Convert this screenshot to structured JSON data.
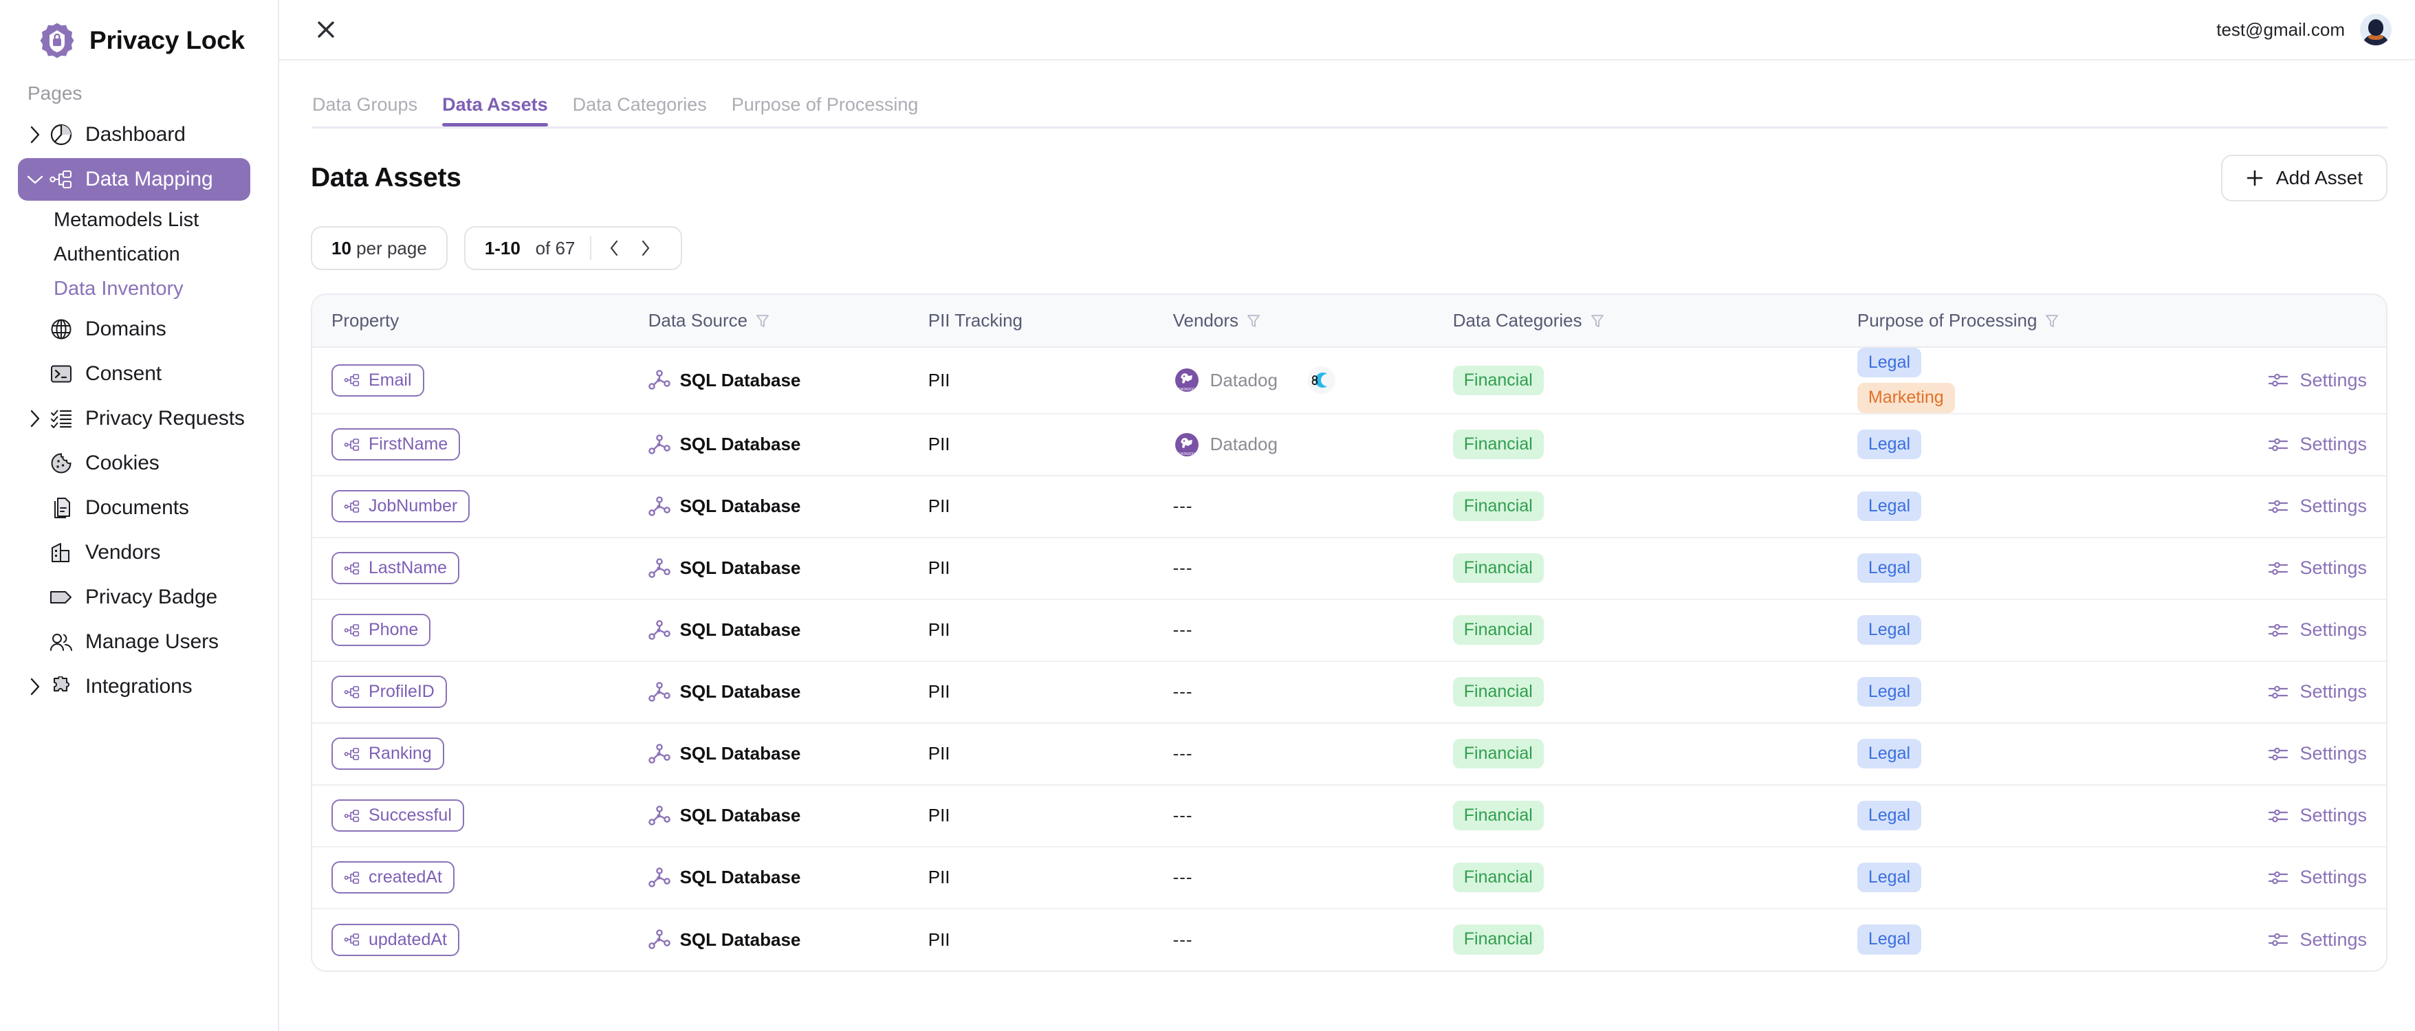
{
  "brand": {
    "title": "Privacy Lock",
    "logo_icon": "shield-lock-badge-icon",
    "color": "#8b72b8"
  },
  "sidebar": {
    "section_label": "Pages",
    "items": [
      {
        "label": "Dashboard",
        "icon": "pie-chart-icon",
        "expandable": true,
        "active": false
      },
      {
        "label": "Data Mapping",
        "icon": "sitemap-icon",
        "expandable": true,
        "active": true
      },
      {
        "label": "Domains",
        "icon": "globe-icon",
        "expandable": false,
        "active": false
      },
      {
        "label": "Consent",
        "icon": "terminal-icon",
        "expandable": false,
        "active": false
      },
      {
        "label": "Privacy Requests",
        "icon": "checklist-icon",
        "expandable": true,
        "active": false
      },
      {
        "label": "Cookies",
        "icon": "cookie-icon",
        "expandable": false,
        "active": false
      },
      {
        "label": "Documents",
        "icon": "documents-icon",
        "expandable": false,
        "active": false
      },
      {
        "label": "Vendors",
        "icon": "building-icon",
        "expandable": false,
        "active": false
      },
      {
        "label": "Privacy Badge",
        "icon": "tag-icon",
        "expandable": false,
        "active": false
      },
      {
        "label": "Manage Users",
        "icon": "users-icon",
        "expandable": false,
        "active": false
      },
      {
        "label": "Integrations",
        "icon": "puzzle-icon",
        "expandable": true,
        "active": false
      }
    ],
    "sub_items": [
      {
        "label": "Metamodels List",
        "current": false
      },
      {
        "label": "Authentication",
        "current": false
      },
      {
        "label": "Data Inventory",
        "current": true
      }
    ]
  },
  "topbar": {
    "close_icon": "close-icon",
    "user_email": "test@gmail.com",
    "avatar_icon": "user-avatar"
  },
  "tabs": [
    {
      "label": "Data Groups",
      "active": false
    },
    {
      "label": "Data Assets",
      "active": true
    },
    {
      "label": "Data Categories",
      "active": false
    },
    {
      "label": "Purpose of Processing",
      "active": false
    }
  ],
  "page": {
    "title": "Data Assets",
    "add_button": {
      "label": "Add Asset",
      "icon": "plus-icon"
    }
  },
  "toolbar": {
    "per_page_value": "10",
    "per_page_suffix": "per page",
    "range": "1-10",
    "range_suffix": "of 67",
    "prev_icon": "chevron-left-icon",
    "next_icon": "chevron-right-icon"
  },
  "table": {
    "columns": [
      {
        "label": "Property",
        "filter": false
      },
      {
        "label": "Data Source",
        "filter": true
      },
      {
        "label": "PII Tracking",
        "filter": false
      },
      {
        "label": "Vendors",
        "filter": true
      },
      {
        "label": "Data Categories",
        "filter": true
      },
      {
        "label": "Purpose of Processing",
        "filter": true
      },
      {
        "label": "",
        "filter": false
      }
    ],
    "settings_label": "Settings",
    "settings_icon": "sliders-icon",
    "empty_value": "---",
    "rows": [
      {
        "property": "Email",
        "data_source": "SQL Database",
        "pii": "PII",
        "vendors": [
          "Datadog"
        ],
        "extra_vendor": true,
        "categories": [
          "Financial"
        ],
        "purposes": [
          "Legal",
          "Marketing"
        ]
      },
      {
        "property": "FirstName",
        "data_source": "SQL Database",
        "pii": "PII",
        "vendors": [
          "Datadog"
        ],
        "extra_vendor": false,
        "categories": [
          "Financial"
        ],
        "purposes": [
          "Legal"
        ]
      },
      {
        "property": "JobNumber",
        "data_source": "SQL Database",
        "pii": "PII",
        "vendors": [],
        "extra_vendor": false,
        "categories": [
          "Financial"
        ],
        "purposes": [
          "Legal"
        ]
      },
      {
        "property": "LastName",
        "data_source": "SQL Database",
        "pii": "PII",
        "vendors": [],
        "extra_vendor": false,
        "categories": [
          "Financial"
        ],
        "purposes": [
          "Legal"
        ]
      },
      {
        "property": "Phone",
        "data_source": "SQL Database",
        "pii": "PII",
        "vendors": [],
        "extra_vendor": false,
        "categories": [
          "Financial"
        ],
        "purposes": [
          "Legal"
        ]
      },
      {
        "property": "ProfileID",
        "data_source": "SQL Database",
        "pii": "PII",
        "vendors": [],
        "extra_vendor": false,
        "categories": [
          "Financial"
        ],
        "purposes": [
          "Legal"
        ]
      },
      {
        "property": "Ranking",
        "data_source": "SQL Database",
        "pii": "PII",
        "vendors": [],
        "extra_vendor": false,
        "categories": [
          "Financial"
        ],
        "purposes": [
          "Legal"
        ]
      },
      {
        "property": "Successful",
        "data_source": "SQL Database",
        "pii": "PII",
        "vendors": [],
        "extra_vendor": false,
        "categories": [
          "Financial"
        ],
        "purposes": [
          "Legal"
        ]
      },
      {
        "property": "createdAt",
        "data_source": "SQL Database",
        "pii": "PII",
        "vendors": [],
        "extra_vendor": false,
        "categories": [
          "Financial"
        ],
        "purposes": [
          "Legal"
        ]
      },
      {
        "property": "updatedAt",
        "data_source": "SQL Database",
        "pii": "PII",
        "vendors": [],
        "extra_vendor": false,
        "categories": [
          "Financial"
        ],
        "purposes": [
          "Legal"
        ]
      }
    ]
  },
  "colors": {
    "accent_purple": "#8b72b8",
    "tab_active": "#7e5fb5",
    "tag_green_bg": "#d8f5dd",
    "tag_green_fg": "#2f9e4f",
    "tag_blue_bg": "#d6e2fb",
    "tag_blue_fg": "#3a6fe0",
    "tag_orange_bg": "#fbe4cf",
    "tag_orange_fg": "#e2702a"
  }
}
